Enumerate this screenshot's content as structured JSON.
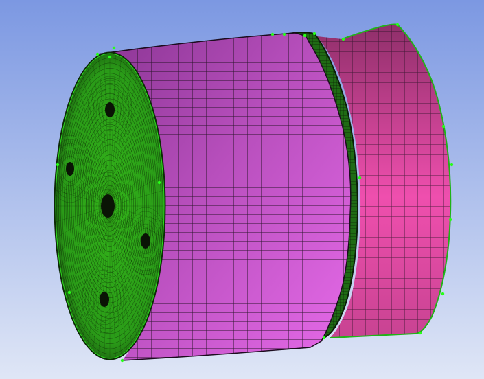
{
  "viewport": {
    "background_top": "#7c98e2",
    "background_bottom": "#dfe6f6"
  },
  "model": {
    "face_mesh_color": "#33b51a",
    "face_dark_color": "#0b1f05",
    "hole_color": "#0a1405",
    "mesh_line_color": "#1d0f1d",
    "ring_mesh_color": "#2fae1f",
    "front_cylinder": {
      "base_color": "#b84fbd",
      "light_color": "#e66ae9",
      "dark_color": "#8a3593"
    },
    "rear_cylinder": {
      "base_color": "#c84392",
      "light_color": "#ef4fae",
      "dark_color": "#8f2f6a"
    },
    "vertex_color": "#27ff18"
  }
}
